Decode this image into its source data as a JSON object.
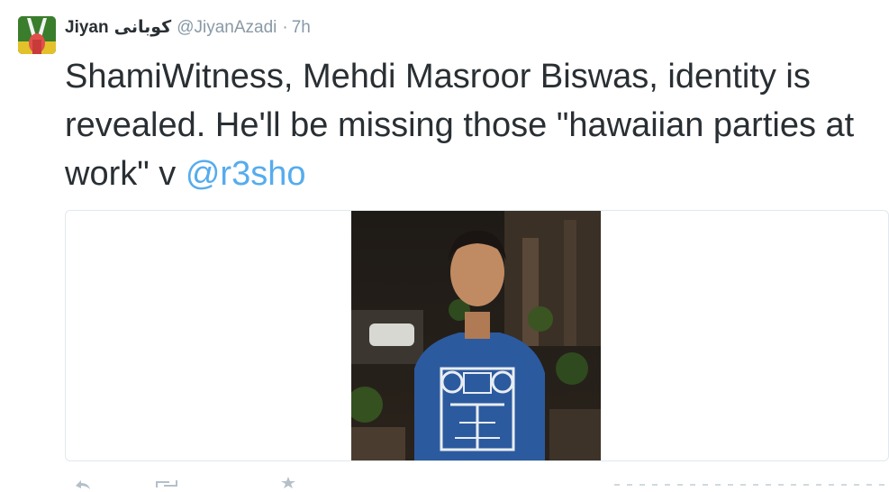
{
  "tweet": {
    "author_name": "Jiyan",
    "author_name_arabic": "كوبانى",
    "handle": "@JiyanAzadi",
    "separator": "·",
    "timestamp": "7h",
    "text_before_mention": "ShamiWitness, Mehdi Masroor Biswas, identity is revealed. He'll be missing those \"hawaiian parties at work\"  v ",
    "mention": "@r3sho"
  },
  "icons": {
    "avatar": "profile-avatar",
    "photo": "tweet-photo",
    "actions": [
      "reply-icon",
      "retweet-icon",
      "favorite-icon",
      "more-icon"
    ]
  },
  "colors": {
    "link": "#55acee",
    "text": "#292f33",
    "meta": "#8899a6",
    "border": "#e1e8ed"
  }
}
